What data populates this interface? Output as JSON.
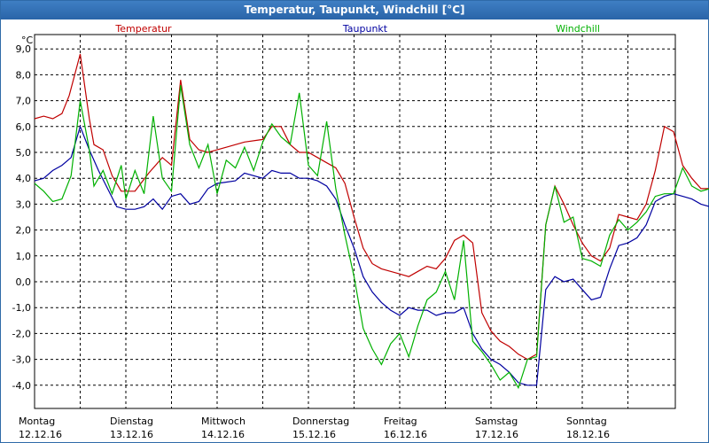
{
  "window": {
    "title": "Temperatur, Taupunkt, Windchill [°C]"
  },
  "chart_data": {
    "type": "line",
    "title": "Temperatur, Taupunkt, Windchill [°C]",
    "ylabel": "°C",
    "ylim": [
      -4.6,
      9.5
    ],
    "xlim": [
      0,
      7
    ],
    "grid": true,
    "yticks": [
      9.0,
      8.0,
      7.0,
      6.0,
      5.0,
      4.0,
      3.0,
      2.0,
      1.0,
      0.0,
      -1.0,
      -2.0,
      -3.0,
      -4.0
    ],
    "ytick_labels": [
      "9,0",
      "8,0",
      "7,0",
      "6,0",
      "5,0",
      "4,0",
      "3,0",
      "2,0",
      "1,0",
      "0,0",
      "-1,0",
      "-2,0",
      "-3,0",
      "-4,0"
    ],
    "xticks": [
      {
        "day": "Montag",
        "date": "12.12.16"
      },
      {
        "day": "Dienstag",
        "date": "13.12.16"
      },
      {
        "day": "Mittwoch",
        "date": "14.12.16"
      },
      {
        "day": "Donnerstag",
        "date": "15.12.16"
      },
      {
        "day": "Freitag",
        "date": "16.12.16"
      },
      {
        "day": "Samstag",
        "date": "17.12.16"
      },
      {
        "day": "Sonntag",
        "date": "18.12.16"
      }
    ],
    "series": [
      {
        "name": "Temperatur",
        "color": "#c00000",
        "points": [
          [
            0,
            6.3
          ],
          [
            0.1,
            6.4
          ],
          [
            0.2,
            6.3
          ],
          [
            0.3,
            6.5
          ],
          [
            0.38,
            7.2
          ],
          [
            0.5,
            8.8
          ],
          [
            0.6,
            6.3
          ],
          [
            0.65,
            5.3
          ],
          [
            0.75,
            5.1
          ],
          [
            0.85,
            4.1
          ],
          [
            0.95,
            3.5
          ],
          [
            1.1,
            3.5
          ],
          [
            1.25,
            4.2
          ],
          [
            1.4,
            4.8
          ],
          [
            1.5,
            4.5
          ],
          [
            1.6,
            7.8
          ],
          [
            1.7,
            5.5
          ],
          [
            1.8,
            5.1
          ],
          [
            1.9,
            5.0
          ],
          [
            2.0,
            5.1
          ],
          [
            2.1,
            5.2
          ],
          [
            2.3,
            5.4
          ],
          [
            2.5,
            5.5
          ],
          [
            2.6,
            6.0
          ],
          [
            2.7,
            6.0
          ],
          [
            2.8,
            5.3
          ],
          [
            2.9,
            5.0
          ],
          [
            3.0,
            5.0
          ],
          [
            3.1,
            4.8
          ],
          [
            3.2,
            4.6
          ],
          [
            3.3,
            4.4
          ],
          [
            3.4,
            3.8
          ],
          [
            3.5,
            2.5
          ],
          [
            3.6,
            1.3
          ],
          [
            3.7,
            0.7
          ],
          [
            3.8,
            0.5
          ],
          [
            3.9,
            0.4
          ],
          [
            4.0,
            0.3
          ],
          [
            4.1,
            0.2
          ],
          [
            4.2,
            0.4
          ],
          [
            4.3,
            0.6
          ],
          [
            4.4,
            0.5
          ],
          [
            4.5,
            0.9
          ],
          [
            4.6,
            1.6
          ],
          [
            4.7,
            1.8
          ],
          [
            4.8,
            1.5
          ],
          [
            4.9,
            -1.2
          ],
          [
            5.0,
            -1.9
          ],
          [
            5.1,
            -2.3
          ],
          [
            5.2,
            -2.5
          ],
          [
            5.3,
            -2.8
          ],
          [
            5.4,
            -3.0
          ],
          [
            5.5,
            -2.8
          ],
          [
            5.6,
            2.2
          ],
          [
            5.7,
            3.7
          ],
          [
            5.8,
            3.0
          ],
          [
            5.9,
            2.2
          ],
          [
            6.0,
            1.5
          ],
          [
            6.1,
            1.0
          ],
          [
            6.2,
            0.8
          ],
          [
            6.3,
            1.3
          ],
          [
            6.4,
            2.6
          ],
          [
            6.5,
            2.5
          ],
          [
            6.6,
            2.4
          ],
          [
            6.7,
            3.0
          ],
          [
            6.8,
            4.3
          ],
          [
            6.9,
            6.0
          ],
          [
            7.0,
            5.8
          ],
          [
            7.1,
            4.5
          ],
          [
            7.2,
            4.0
          ],
          [
            7.3,
            3.6
          ],
          [
            7.4,
            3.6
          ]
        ]
      },
      {
        "name": "Taupunkt",
        "color": "#0000a0",
        "points": [
          [
            0,
            3.9
          ],
          [
            0.1,
            4.0
          ],
          [
            0.2,
            4.3
          ],
          [
            0.3,
            4.5
          ],
          [
            0.4,
            4.8
          ],
          [
            0.5,
            6.0
          ],
          [
            0.6,
            5.1
          ],
          [
            0.7,
            4.3
          ],
          [
            0.8,
            3.6
          ],
          [
            0.9,
            2.9
          ],
          [
            1.0,
            2.8
          ],
          [
            1.1,
            2.8
          ],
          [
            1.2,
            2.9
          ],
          [
            1.3,
            3.2
          ],
          [
            1.4,
            2.8
          ],
          [
            1.5,
            3.3
          ],
          [
            1.6,
            3.4
          ],
          [
            1.7,
            3.0
          ],
          [
            1.8,
            3.1
          ],
          [
            1.9,
            3.6
          ],
          [
            2.0,
            3.8
          ],
          [
            2.2,
            3.9
          ],
          [
            2.3,
            4.2
          ],
          [
            2.5,
            4.0
          ],
          [
            2.6,
            4.3
          ],
          [
            2.7,
            4.2
          ],
          [
            2.8,
            4.2
          ],
          [
            2.9,
            4.0
          ],
          [
            3.0,
            4.0
          ],
          [
            3.1,
            3.9
          ],
          [
            3.2,
            3.7
          ],
          [
            3.3,
            3.2
          ],
          [
            3.4,
            2.2
          ],
          [
            3.5,
            1.3
          ],
          [
            3.6,
            0.2
          ],
          [
            3.7,
            -0.4
          ],
          [
            3.8,
            -0.8
          ],
          [
            3.9,
            -1.1
          ],
          [
            4.0,
            -1.3
          ],
          [
            4.1,
            -1.0
          ],
          [
            4.2,
            -1.1
          ],
          [
            4.3,
            -1.1
          ],
          [
            4.4,
            -1.3
          ],
          [
            4.5,
            -1.2
          ],
          [
            4.6,
            -1.2
          ],
          [
            4.7,
            -1.0
          ],
          [
            4.8,
            -2.0
          ],
          [
            4.9,
            -2.6
          ],
          [
            5.0,
            -3.0
          ],
          [
            5.1,
            -3.2
          ],
          [
            5.2,
            -3.5
          ],
          [
            5.3,
            -3.9
          ],
          [
            5.4,
            -4.0
          ],
          [
            5.5,
            -4.0
          ],
          [
            5.6,
            -0.3
          ],
          [
            5.7,
            0.2
          ],
          [
            5.8,
            0.0
          ],
          [
            5.9,
            0.1
          ],
          [
            6.0,
            -0.3
          ],
          [
            6.1,
            -0.7
          ],
          [
            6.2,
            -0.6
          ],
          [
            6.3,
            0.5
          ],
          [
            6.4,
            1.4
          ],
          [
            6.5,
            1.5
          ],
          [
            6.6,
            1.7
          ],
          [
            6.7,
            2.2
          ],
          [
            6.8,
            3.1
          ],
          [
            6.9,
            3.3
          ],
          [
            7.0,
            3.4
          ],
          [
            7.1,
            3.3
          ],
          [
            7.2,
            3.2
          ],
          [
            7.3,
            3.0
          ],
          [
            7.4,
            2.9
          ]
        ]
      },
      {
        "name": "Windchill",
        "color": "#00b000",
        "points": [
          [
            0,
            3.8
          ],
          [
            0.1,
            3.5
          ],
          [
            0.2,
            3.1
          ],
          [
            0.3,
            3.2
          ],
          [
            0.4,
            4.1
          ],
          [
            0.5,
            7.0
          ],
          [
            0.6,
            5.1
          ],
          [
            0.65,
            3.7
          ],
          [
            0.75,
            4.3
          ],
          [
            0.85,
            3.4
          ],
          [
            0.95,
            4.5
          ],
          [
            1.0,
            3.2
          ],
          [
            1.1,
            4.3
          ],
          [
            1.2,
            3.4
          ],
          [
            1.3,
            6.4
          ],
          [
            1.4,
            4.0
          ],
          [
            1.5,
            3.5
          ],
          [
            1.6,
            7.6
          ],
          [
            1.7,
            5.3
          ],
          [
            1.8,
            4.4
          ],
          [
            1.9,
            5.3
          ],
          [
            2.0,
            3.4
          ],
          [
            2.1,
            4.7
          ],
          [
            2.2,
            4.4
          ],
          [
            2.3,
            5.2
          ],
          [
            2.4,
            4.3
          ],
          [
            2.5,
            5.4
          ],
          [
            2.6,
            6.1
          ],
          [
            2.7,
            5.6
          ],
          [
            2.8,
            5.3
          ],
          [
            2.9,
            7.3
          ],
          [
            3.0,
            4.5
          ],
          [
            3.1,
            4.1
          ],
          [
            3.2,
            6.2
          ],
          [
            3.3,
            3.6
          ],
          [
            3.4,
            1.8
          ],
          [
            3.5,
            0.2
          ],
          [
            3.6,
            -1.8
          ],
          [
            3.7,
            -2.6
          ],
          [
            3.8,
            -3.2
          ],
          [
            3.9,
            -2.4
          ],
          [
            4.0,
            -2.0
          ],
          [
            4.1,
            -2.9
          ],
          [
            4.2,
            -1.7
          ],
          [
            4.3,
            -0.7
          ],
          [
            4.4,
            -0.4
          ],
          [
            4.5,
            0.4
          ],
          [
            4.6,
            -0.7
          ],
          [
            4.7,
            1.6
          ],
          [
            4.8,
            -2.3
          ],
          [
            4.9,
            -2.7
          ],
          [
            5.0,
            -3.2
          ],
          [
            5.1,
            -3.8
          ],
          [
            5.2,
            -3.5
          ],
          [
            5.3,
            -4.1
          ],
          [
            5.4,
            -3.0
          ],
          [
            5.5,
            -2.9
          ],
          [
            5.6,
            2.2
          ],
          [
            5.7,
            3.7
          ],
          [
            5.8,
            2.3
          ],
          [
            5.9,
            2.5
          ],
          [
            6.0,
            0.9
          ],
          [
            6.1,
            0.8
          ],
          [
            6.2,
            0.6
          ],
          [
            6.3,
            1.8
          ],
          [
            6.4,
            2.4
          ],
          [
            6.5,
            2.0
          ],
          [
            6.6,
            2.3
          ],
          [
            6.7,
            2.7
          ],
          [
            6.8,
            3.3
          ],
          [
            6.9,
            3.4
          ],
          [
            7.0,
            3.4
          ],
          [
            7.1,
            4.4
          ],
          [
            7.2,
            3.7
          ],
          [
            7.3,
            3.5
          ],
          [
            7.4,
            3.6
          ]
        ]
      }
    ]
  }
}
